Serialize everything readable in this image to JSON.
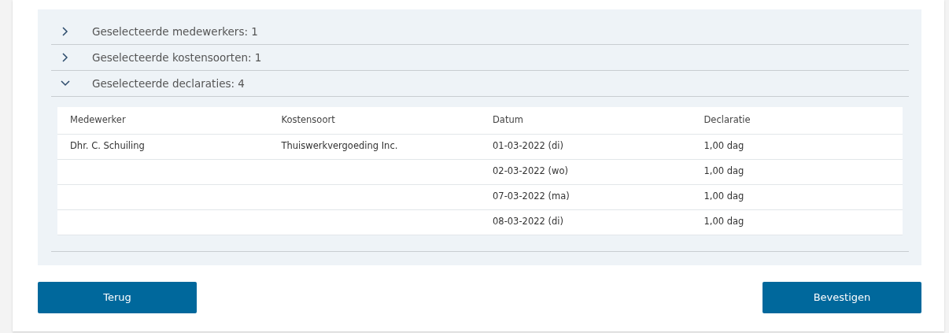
{
  "sections": [
    {
      "title": "Geselecteerde medewerkers: 1",
      "expanded": false
    },
    {
      "title": "Geselecteerde kostensoorten: 1",
      "expanded": false
    },
    {
      "title": "Geselecteerde declaraties: 4",
      "expanded": true,
      "table": {
        "columns": [
          "Medewerker",
          "Kostensoort",
          "Datum",
          "Declaratie"
        ],
        "rows": [
          [
            "Dhr. C. Schuiling",
            "Thuiswerkvergoeding Inc.",
            "01-03-2022 (di)",
            "1,00 dag"
          ],
          [
            "",
            "",
            "02-03-2022 (wo)",
            "1,00 dag"
          ],
          [
            "",
            "",
            "07-03-2022 (ma)",
            "1,00 dag"
          ],
          [
            "",
            "",
            "08-03-2022 (di)",
            "1,00 dag"
          ]
        ]
      }
    }
  ],
  "buttons": [
    {
      "label": "Terug"
    },
    {
      "label": "Bevestigen"
    }
  ]
}
